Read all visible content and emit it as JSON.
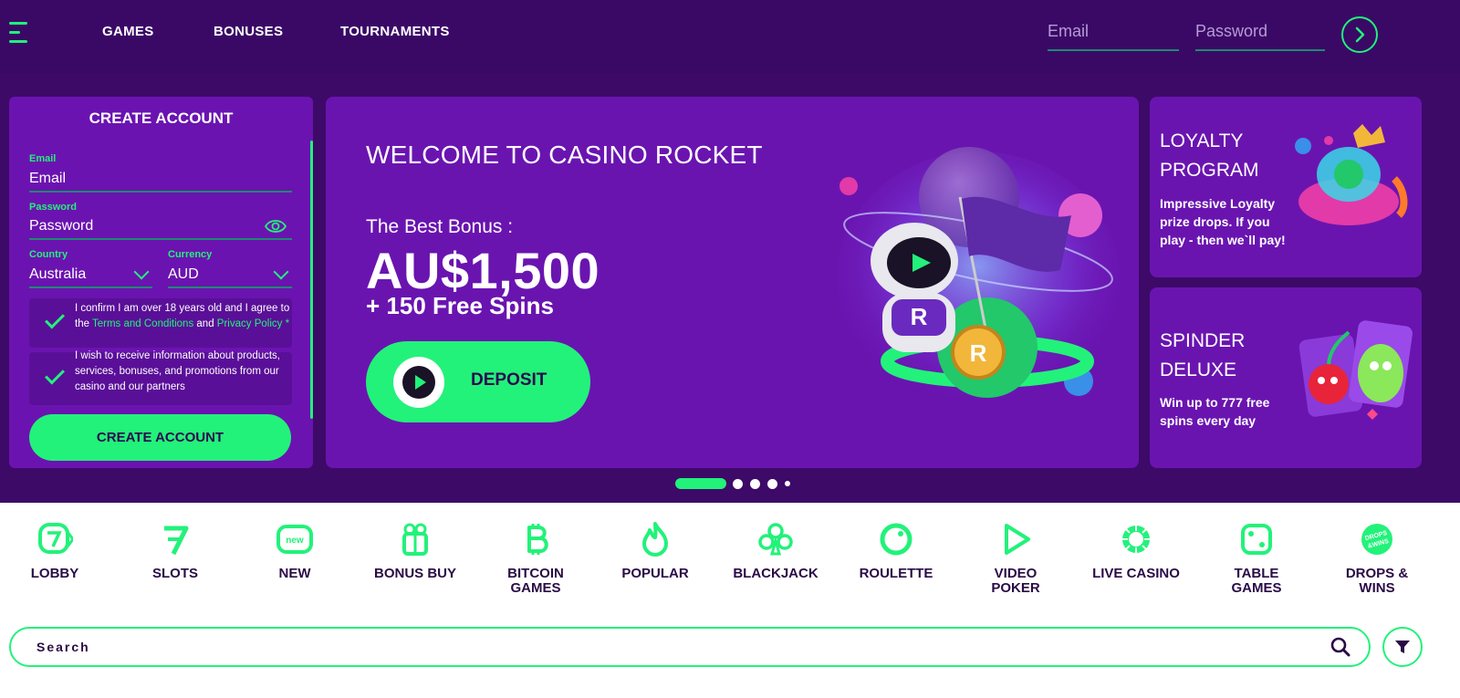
{
  "header": {
    "nav": [
      "GAMES",
      "BONUSES",
      "TOURNAMENTS"
    ],
    "email_placeholder": "Email",
    "password_placeholder": "Password",
    "submit_icon": "chevron-right-icon"
  },
  "create_account": {
    "title": "CREATE ACCOUNT",
    "email_label": "Email",
    "email_placeholder": "Email",
    "password_label": "Password",
    "password_placeholder": "Password",
    "country_label": "Country",
    "country_value": "Australia",
    "currency_label": "Currency",
    "currency_value": "AUD",
    "terms_text_1": "I confirm I am over 18 years old and I agree to the ",
    "terms_link": "Terms and Conditions",
    "terms_text_2": " and ",
    "privacy_link": "Privacy Policy *",
    "marketing_text": "I wish to receive information about products, services, bonuses, and promotions from our casino and our partners",
    "button": "CREATE ACCOUNT"
  },
  "hero": {
    "title": "WELCOME TO CASINO ROCKET",
    "subtitle": "The Best Bonus :",
    "amount": "AU$1,500",
    "spins": "+ 150 Free Spins",
    "deposit": "DEPOSIT"
  },
  "cards": [
    {
      "title1": "LOYALTY",
      "title2": "PROGRAM",
      "desc": "Impressive Loyalty prize drops. If you play - then we`ll pay!"
    },
    {
      "title1": "SPINDER",
      "title2": "DELUXE",
      "desc": "Win up to 777 free spins every day"
    }
  ],
  "carousel": {
    "slides": 5,
    "active": 1
  },
  "categories": [
    {
      "label": "LOBBY",
      "icon": "lobby-icon"
    },
    {
      "label": "SLOTS",
      "icon": "slots-icon"
    },
    {
      "label": "NEW",
      "icon": "new-icon",
      "badge": "new"
    },
    {
      "label": "BONUS BUY",
      "icon": "gift-icon"
    },
    {
      "label": "BITCOIN GAMES",
      "icon": "bitcoin-icon"
    },
    {
      "label": "POPULAR",
      "icon": "flame-icon"
    },
    {
      "label": "BLACKJACK",
      "icon": "club-icon"
    },
    {
      "label": "ROULETTE",
      "icon": "roulette-icon"
    },
    {
      "label": "VIDEO POKER",
      "icon": "play-icon"
    },
    {
      "label": "LIVE CASINO",
      "icon": "live-icon"
    },
    {
      "label": "TABLE GAMES",
      "icon": "dice-icon"
    },
    {
      "label": "DROPS & WINS",
      "icon": "drops-wins-icon",
      "badge": "DROPS & WINS"
    }
  ],
  "search": {
    "placeholder": "Search"
  },
  "colors": {
    "accent": "#22f27a",
    "purple_dark": "#3a0966",
    "purple": "#6a14b0",
    "text_dark": "#2a0b46"
  }
}
